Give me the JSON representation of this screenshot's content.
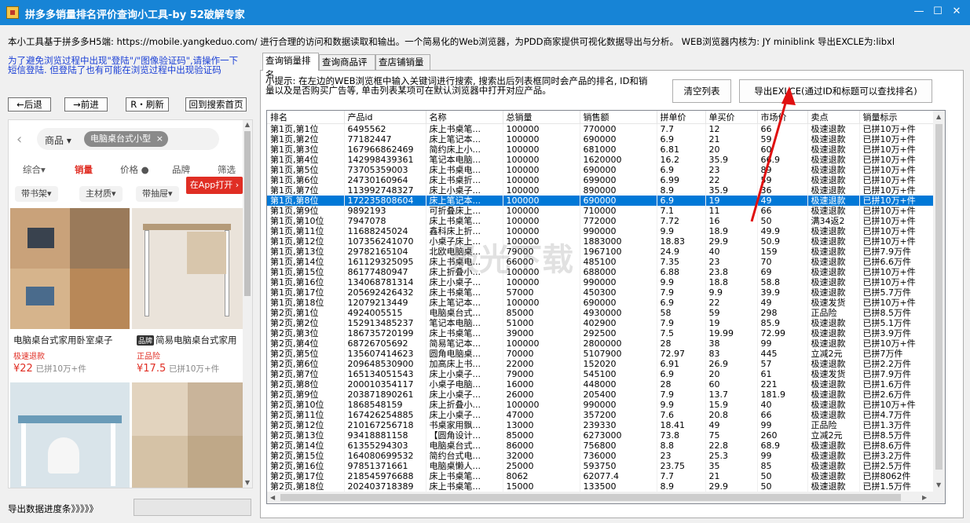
{
  "window": {
    "title": "拼多多销量排名评价查询小工具-by 52破解专家",
    "controls": [
      "—",
      "☐",
      "✕"
    ]
  },
  "intro": "本小工具基于拼多多H5端: https://mobile.yangkeduo.com/ 进行合理的访问和数据读取和输出。一个简易化的Web浏览器，为PDD商家提供可视化数据导出与分析。 WEB浏览器内核为: JY miniblink 导出EXCLE为:libxl",
  "warning": "为了避免浏览过程中出现\"登陆\"/\"图像验证码\",请操作一下短信登陆. 但登陆了也有可能在浏览过程中出现验证码",
  "nav": {
    "back": "←后退",
    "forward": "→前进",
    "refresh": "R・刷新",
    "home": "回到搜索首页"
  },
  "browser": {
    "category": "商品",
    "keyword": "电脑桌台式小型",
    "sort_tabs": [
      "综合",
      "销量",
      "价格",
      "品牌",
      "筛选"
    ],
    "chips": [
      "带书架",
      "主材质",
      "带抽屉"
    ],
    "app_button": "在App打开",
    "products": [
      {
        "name": "电脑桌台式家用卧室桌子",
        "badge": "极速退款",
        "price": "¥22",
        "sold": "已拼10万+件"
      },
      {
        "brand": "品牌",
        "name": "简易电脑桌台式家用",
        "badge": "正品险",
        "price": "¥17.5",
        "sold": "已拼10万+件"
      }
    ]
  },
  "progress": {
    "label": "导出数据进度条》》》》》",
    "value": 0
  },
  "tabs": [
    "查询销量排名",
    "查询商品评价",
    "查店铺销量"
  ],
  "hint": "小提示: 在左边的WEB浏览框中输入关键词进行搜索, 搜索出后列表框同时会产品的排名, ID和销量以及是否购买广告等, 单击列表某项可在默认浏览器中打开对应产品。",
  "buttons": {
    "clear": "清空列表",
    "export": "导出EXLCE(通过ID和标题可以查找排名)"
  },
  "table": {
    "columns": [
      "排名",
      "产品id",
      "名称",
      "总销量",
      "销售额",
      "拼单价",
      "单买价",
      "市场价",
      "卖点",
      "销量标示"
    ],
    "selected_index": 7,
    "rows": [
      [
        "第1页,第1位",
        "6495562",
        "床上书桌笔...",
        "100000",
        "770000",
        "7.7",
        "12",
        "66",
        "极速退款",
        "已拼10万+件"
      ],
      [
        "第1页,第2位",
        "77182447",
        "床上笔记本...",
        "100000",
        "690000",
        "6.9",
        "21",
        "59",
        "极速退款",
        "已拼10万+件"
      ],
      [
        "第1页,第3位",
        "167966862469",
        "简约床上小...",
        "100000",
        "681000",
        "6.81",
        "20",
        "60",
        "极速退款",
        "已拼10万+件"
      ],
      [
        "第1页,第4位",
        "142998439361",
        "笔记本电脑...",
        "100000",
        "1620000",
        "16.2",
        "35.9",
        "66.9",
        "极速退款",
        "已拼10万+件"
      ],
      [
        "第1页,第5位",
        "73705359003",
        "床上书桌电...",
        "100000",
        "690000",
        "6.9",
        "23",
        "89",
        "极速退款",
        "已拼10万+件"
      ],
      [
        "第1页,第6位",
        "24730160964",
        "床上书桌折...",
        "100000",
        "699000",
        "6.99",
        "22",
        "59",
        "极速退款",
        "已拼10万+件"
      ],
      [
        "第1页,第7位",
        "113992748327",
        "床上小桌子...",
        "100000",
        "890000",
        "8.9",
        "35.9",
        "36",
        "极速退款",
        "已拼10万+件"
      ],
      [
        "第1页,第8位",
        "172235808604",
        "床上笔记本...",
        "100000",
        "690000",
        "6.9",
        "19",
        "49",
        "极速退款",
        "已拼10万+件"
      ],
      [
        "第1页,第9位",
        "9892193",
        "可折叠床上...",
        "100000",
        "710000",
        "7.1",
        "11",
        "66",
        "极速退款",
        "已拼10万+件"
      ],
      [
        "第1页,第10位",
        "7947078",
        "床上书桌笔...",
        "100000",
        "772000",
        "7.72",
        "16",
        "50",
        "满34返2",
        "已拼10万+件"
      ],
      [
        "第1页,第11位",
        "11688245024",
        "鑫科床上折...",
        "100000",
        "990000",
        "9.9",
        "18.9",
        "49.9",
        "极速退款",
        "已拼10万+件"
      ],
      [
        "第1页,第12位",
        "107356241070",
        "小桌子床上...",
        "100000",
        "1883000",
        "18.83",
        "29.9",
        "50.9",
        "极速退款",
        "已拼10万+件"
      ],
      [
        "第1页,第13位",
        "29782165104",
        "北欧电脑桌...",
        "79000",
        "1967100",
        "24.9",
        "40",
        "159",
        "极速退款",
        "已拼7.9万件"
      ],
      [
        "第1页,第14位",
        "161129325095",
        "床上书桌电...",
        "66000",
        "485100",
        "7.35",
        "23",
        "70",
        "极速退款",
        "已拼6.6万件"
      ],
      [
        "第1页,第15位",
        "86177480947",
        "床上折叠小...",
        "100000",
        "688000",
        "6.88",
        "23.8",
        "69",
        "极速退款",
        "已拼10万+件"
      ],
      [
        "第1页,第16位",
        "134068781314",
        "床上小桌子...",
        "100000",
        "990000",
        "9.9",
        "18.8",
        "58.8",
        "极速退款",
        "已拼10万+件"
      ],
      [
        "第1页,第17位",
        "205692426432",
        "床上书桌笔...",
        "57000",
        "450300",
        "7.9",
        "9.9",
        "39.9",
        "极速退款",
        "已拼5.7万件"
      ],
      [
        "第1页,第18位",
        "12079213449",
        "床上笔记本...",
        "100000",
        "690000",
        "6.9",
        "22",
        "49",
        "极速发货",
        "已拼10万+件"
      ],
      [
        "第2页,第1位",
        "4924005515",
        "电脑桌台式...",
        "85000",
        "4930000",
        "58",
        "59",
        "298",
        "正品险",
        "已拼8.5万件"
      ],
      [
        "第2页,第2位",
        "152913485237",
        "笔记本电脑...",
        "51000",
        "402900",
        "7.9",
        "19",
        "85.9",
        "极速退款",
        "已拼5.1万件"
      ],
      [
        "第2页,第3位",
        "186735720199",
        "床上书桌笔...",
        "39000",
        "292500",
        "7.5",
        "19.99",
        "72.99",
        "极速退款",
        "已拼3.9万件"
      ],
      [
        "第2页,第4位",
        "68726705692",
        "简易笔记本...",
        "100000",
        "2800000",
        "28",
        "38",
        "99",
        "极速退款",
        "已拼10万+件"
      ],
      [
        "第2页,第5位",
        "135607414623",
        "圆角电脑桌...",
        "70000",
        "5107900",
        "72.97",
        "83",
        "445",
        "立减2元",
        "已拼7万件"
      ],
      [
        "第2页,第6位",
        "209648530900",
        "加高床上书...",
        "22000",
        "152020",
        "6.91",
        "26.9",
        "57",
        "极速退款",
        "已拼2.2万件"
      ],
      [
        "第2页,第7位",
        "165134051543",
        "床上小桌子...",
        "79000",
        "545100",
        "6.9",
        "20",
        "61",
        "极速发货",
        "已拼7.9万件"
      ],
      [
        "第2页,第8位",
        "200010354117",
        "小桌子电脑...",
        "16000",
        "448000",
        "28",
        "60",
        "221",
        "极速退款",
        "已拼1.6万件"
      ],
      [
        "第2页,第9位",
        "203871890261",
        "床上小桌子...",
        "26000",
        "205400",
        "7.9",
        "13.7",
        "181.9",
        "极速退款",
        "已拼2.6万件"
      ],
      [
        "第2页,第10位",
        "1868548159",
        "床上折叠小...",
        "100000",
        "990000",
        "9.9",
        "15.9",
        "40",
        "极速退款",
        "已拼10万+件"
      ],
      [
        "第2页,第11位",
        "167426254885",
        "床上小桌子...",
        "47000",
        "357200",
        "7.6",
        "20.8",
        "66",
        "极速退款",
        "已拼4.7万件"
      ],
      [
        "第2页,第12位",
        "210167256718",
        "书桌家用飘...",
        "13000",
        "239330",
        "18.41",
        "49",
        "99",
        "正品险",
        "已拼1.3万件"
      ],
      [
        "第2页,第13位",
        "93418881158",
        "【圆角设计...",
        "85000",
        "6273000",
        "73.8",
        "75",
        "260",
        "立减2元",
        "已拼8.5万件"
      ],
      [
        "第2页,第14位",
        "61355294303",
        "电脑桌台式...",
        "86000",
        "756800",
        "8.8",
        "22.8",
        "68.9",
        "极速退款",
        "已拼8.6万件"
      ],
      [
        "第2页,第15位",
        "164080699532",
        "简约台式电...",
        "32000",
        "736000",
        "23",
        "25.3",
        "99",
        "极速退款",
        "已拼3.2万件"
      ],
      [
        "第2页,第16位",
        "97851371661",
        "电脑桌懒人...",
        "25000",
        "593750",
        "23.75",
        "35",
        "85",
        "极速退款",
        "已拼2.5万件"
      ],
      [
        "第2页,第17位",
        "218545976688",
        "床上书桌笔...",
        "8062",
        "62077.4",
        "7.7",
        "21",
        "50",
        "极速退款",
        "已拼8062件"
      ],
      [
        "第2页,第18位",
        "202403718389",
        "床上书桌笔...",
        "15000",
        "133500",
        "8.9",
        "29.9",
        "50",
        "极速退款",
        "已拼1.5万件"
      ]
    ]
  },
  "watermark": "极光下载",
  "colors": {
    "titlebar": "#1784d6",
    "selection": "#0078d7",
    "accent": "#e02e24",
    "link": "#1a3fd6"
  }
}
